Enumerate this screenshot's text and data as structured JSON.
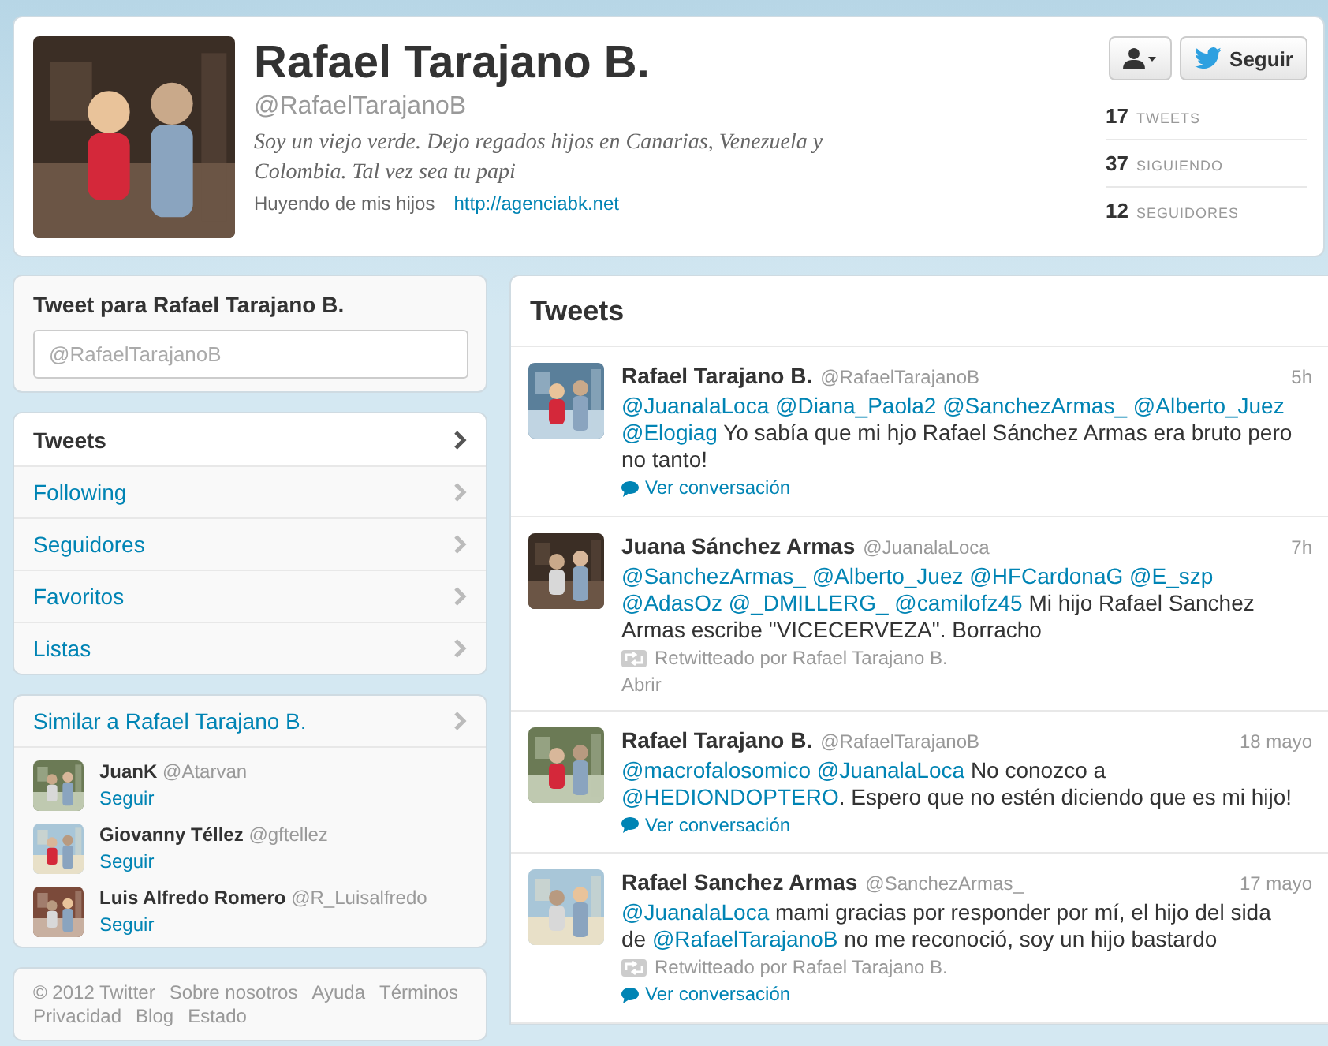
{
  "profile": {
    "name": "Rafael Tarajano B.",
    "handle": "@RafaelTarajanoB",
    "bio": "Soy un viejo verde. Dejo regados hijos en Canarias, Venezuela y Colombia. Tal vez sea tu papi",
    "location": "Huyendo de mis hijos",
    "url": "http://agenciabk.net",
    "follow_label": "Seguir",
    "stats": [
      {
        "count": "17",
        "label": "TWEETS"
      },
      {
        "count": "37",
        "label": "SIGUIENDO"
      },
      {
        "count": "12",
        "label": "SEGUIDORES"
      }
    ]
  },
  "compose": {
    "title": "Tweet para Rafael Tarajano B.",
    "placeholder": "@RafaelTarajanoB"
  },
  "nav": [
    {
      "label": "Tweets",
      "selected": true
    },
    {
      "label": "Following",
      "selected": false
    },
    {
      "label": "Seguidores",
      "selected": false
    },
    {
      "label": "Favoritos",
      "selected": false
    },
    {
      "label": "Listas",
      "selected": false
    }
  ],
  "similar": {
    "title": "Similar a Rafael Tarajano B.",
    "users": [
      {
        "name": "JuanK",
        "handle": "@Atarvan",
        "action": "Seguir"
      },
      {
        "name": "Giovanny Téllez",
        "handle": "@gftellez",
        "action": "Seguir"
      },
      {
        "name": "Luis Alfredo Romero",
        "handle": "@R_Luisalfredo",
        "action": "Seguir"
      }
    ]
  },
  "footer": [
    "© 2012 Twitter",
    "Sobre nosotros",
    "Ayuda",
    "Términos",
    "Privacidad",
    "Blog",
    "Estado"
  ],
  "timeline": {
    "title": "Tweets",
    "tweets": [
      {
        "name": "Rafael Tarajano B.",
        "handle": "@RafaelTarajanoB",
        "time": "5h",
        "text": [
          {
            "kind": "mention",
            "text": "@JuanalaLoca"
          },
          {
            "kind": "mention",
            "text": "@Diana_Paola2"
          },
          {
            "kind": "mention",
            "text": "@SanchezArmas_"
          },
          {
            "kind": "mention",
            "text": "@Alberto_Juez"
          },
          {
            "kind": "mention",
            "text": "@Elogiag"
          },
          {
            "kind": "text",
            "text": "Yo sabía que mi hjo Rafael Sánchez Armas era bruto pero no tanto!"
          }
        ],
        "action": {
          "kind": "conversation",
          "label": "Ver conversación"
        }
      },
      {
        "name": "Juana Sánchez Armas",
        "handle": "@JuanalaLoca",
        "time": "7h",
        "text": [
          {
            "kind": "mention",
            "text": "@SanchezArmas_"
          },
          {
            "kind": "mention",
            "text": "@Alberto_Juez"
          },
          {
            "kind": "mention",
            "text": "@HFCardonaG"
          },
          {
            "kind": "mention",
            "text": "@E_szp"
          },
          {
            "kind": "mention",
            "text": "@AdasOz"
          },
          {
            "kind": "mention",
            "text": "@_DMILLERG_"
          },
          {
            "kind": "mention",
            "text": "@camilofz45"
          },
          {
            "kind": "text",
            "text": "Mi hijo Rafael Sanchez Armas escribe \"VICECERVEZA\". Borracho"
          }
        ],
        "retweeted_by": "Retwitteado por Rafael Tarajano B.",
        "action": {
          "kind": "open",
          "label": "Abrir"
        }
      },
      {
        "name": "Rafael Tarajano B.",
        "handle": "@RafaelTarajanoB",
        "time": "18 mayo",
        "text": [
          {
            "kind": "mention",
            "text": "@macrofalosomico"
          },
          {
            "kind": "mention",
            "text": "@JuanalaLoca"
          },
          {
            "kind": "text",
            "text": "No conozco a"
          },
          {
            "kind": "mention",
            "text": "@HEDIONDOPTERO"
          },
          {
            "kind": "text",
            "text": ". Espero que no estén diciendo que es mi hijo!",
            "attach": true
          }
        ],
        "action": {
          "kind": "conversation",
          "label": "Ver conversación"
        }
      },
      {
        "name": "Rafael Sanchez Armas",
        "handle": "@SanchezArmas_",
        "time": "17 mayo",
        "text": [
          {
            "kind": "mention",
            "text": "@JuanalaLoca"
          },
          {
            "kind": "text",
            "text": "mami gracias por responder por mí, el hijo del sida de"
          },
          {
            "kind": "mention",
            "text": "@RafaelTarajanoB"
          },
          {
            "kind": "text",
            "text": "no me reconoció, soy un hijo bastardo"
          }
        ],
        "retweeted_by": "Retwitteado por Rafael Tarajano B.",
        "action": {
          "kind": "conversation",
          "label": "Ver conversación"
        }
      }
    ]
  }
}
